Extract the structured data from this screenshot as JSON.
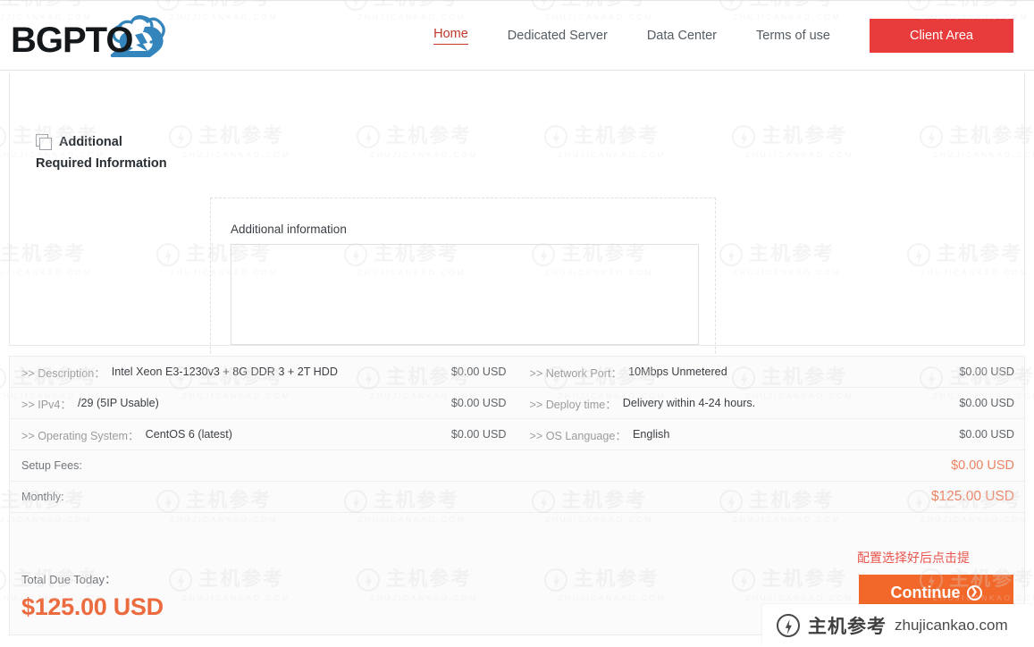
{
  "brand": {
    "logo_text": "BGPTO",
    "accent_red": "#e83c3c",
    "accent_orange": "#f2682a",
    "price_orange": "#ec8464",
    "total_orange": "#ec6b3e",
    "logo_blue": "#2f7fb8"
  },
  "nav": {
    "items": [
      {
        "label": "Home",
        "active": true
      },
      {
        "label": "Dedicated Server",
        "active": false
      },
      {
        "label": "Data Center",
        "active": false
      },
      {
        "label": "Terms of use",
        "active": false
      }
    ],
    "client_area_label": "Client Area"
  },
  "additional": {
    "heading_line1": "Additional",
    "heading_line2": "Required Information",
    "field_label": "Additional information",
    "textarea_value": "",
    "textarea_placeholder": ""
  },
  "summary": {
    "rows": [
      {
        "left_key": ">> Description：",
        "left_value": "Intel Xeon E3-1230v3 + 8G DDR 3 + 2T HDD",
        "left_price": "$0.00 USD",
        "right_key": ">> Network Port：",
        "right_value": "10Mbps Unmetered",
        "right_price": "$0.00 USD"
      },
      {
        "left_key": ">> IPv4：",
        "left_value": "/29 (5IP Usable)",
        "left_price": "$0.00 USD",
        "right_key": ">> Deploy time：",
        "right_value": "Delivery within 4-24 hours.",
        "right_price": "$0.00 USD"
      },
      {
        "left_key": ">> Operating System：",
        "left_value": "CentOS 6 (latest)",
        "left_price": "$0.00 USD",
        "right_key": ">> OS Language：",
        "right_value": "English",
        "right_price": "$0.00 USD"
      }
    ],
    "setup_fees_label": "Setup Fees:",
    "setup_fees_value": "$0.00 USD",
    "monthly_label": "Monthly:",
    "monthly_value": "$125.00 USD",
    "total_label": "Total Due Today：",
    "total_value": "$125.00 USD"
  },
  "actions": {
    "annotation": "配置选择好后点击提",
    "continue_label": "Continue",
    "continue_arrow": "❯"
  },
  "watermark": {
    "cn": "主机参考",
    "url_upper": "ZHUJICANKAO.COM",
    "url": "zhujicankao.com"
  }
}
